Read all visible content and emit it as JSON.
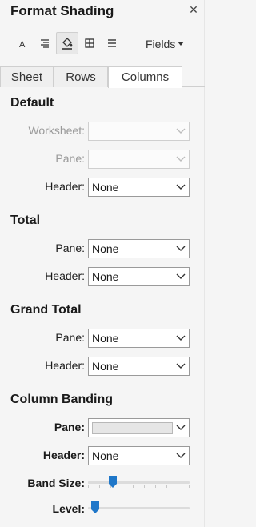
{
  "header": {
    "title": "Format Shading",
    "close_icon": "close-icon"
  },
  "toolbar": {
    "buttons": [
      {
        "name": "font-icon"
      },
      {
        "name": "alignment-icon"
      },
      {
        "name": "shading-icon",
        "selected": true
      },
      {
        "name": "borders-icon"
      },
      {
        "name": "lines-icon"
      }
    ],
    "fields_label": "Fields"
  },
  "tabs": [
    {
      "label": "Sheet",
      "active": false
    },
    {
      "label": "Rows",
      "active": false
    },
    {
      "label": "Columns",
      "active": true
    }
  ],
  "default": {
    "heading": "Default",
    "worksheet_label": "Worksheet:",
    "worksheet_value": "",
    "pane_label": "Pane:",
    "pane_value": "",
    "header_label": "Header:",
    "header_value": "None"
  },
  "total": {
    "heading": "Total",
    "pane_label": "Pane:",
    "pane_value": "None",
    "header_label": "Header:",
    "header_value": "None"
  },
  "grand_total": {
    "heading": "Grand Total",
    "pane_label": "Pane:",
    "pane_value": "None",
    "header_label": "Header:",
    "header_value": "None"
  },
  "column_banding": {
    "heading": "Column Banding",
    "pane_label": "Pane:",
    "pane_swatch_color": "#e6e6e6",
    "header_label": "Header:",
    "header_value": "None",
    "band_size_label": "Band Size:",
    "band_size_position": 0.22,
    "level_label": "Level:",
    "level_position": 0.03
  },
  "colors": {
    "accent": "#1f77c9",
    "border": "#9a9a9a",
    "disabled_text": "#9a9a9a"
  }
}
